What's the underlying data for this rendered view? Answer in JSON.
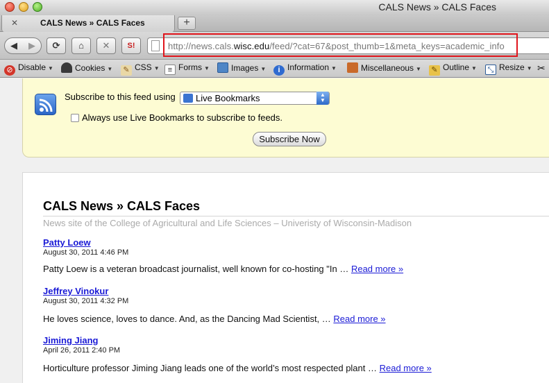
{
  "window": {
    "title": "CALS News » CALS Faces"
  },
  "tabs": [
    {
      "label": "CALS News » CALS Faces",
      "close_glyph": "✕"
    }
  ],
  "new_tab": {
    "label": "+"
  },
  "nav": {
    "back_glyph": "◀",
    "forward_glyph": "▶",
    "reload_glyph": "⟳",
    "home_glyph": "⌂",
    "stop_glyph": "✕",
    "si_label": "S!",
    "url_prefix": "http://news.cals.",
    "url_domain": "wisc.edu",
    "url_suffix": "/feed/?cat=67&post_thumb=1&meta_keys=academic_info"
  },
  "devbar": {
    "items": [
      {
        "label": "Disable",
        "icon": "disable-icon"
      },
      {
        "label": "Cookies",
        "icon": "cookies-icon"
      },
      {
        "label": "CSS",
        "icon": "css-icon"
      },
      {
        "label": "Forms",
        "icon": "forms-icon"
      },
      {
        "label": "Images",
        "icon": "images-icon"
      },
      {
        "label": "Information",
        "icon": "information-icon"
      },
      {
        "label": "Miscellaneous",
        "icon": "miscellaneous-icon"
      },
      {
        "label": "Outline",
        "icon": "outline-icon"
      },
      {
        "label": "Resize",
        "icon": "resize-icon"
      }
    ]
  },
  "subscribe": {
    "label": "Subscribe to this feed using",
    "reader_selected": "Live Bookmarks",
    "always_label": "Always use Live Bookmarks to subscribe to feeds.",
    "always_checked": false,
    "button_label": "Subscribe Now"
  },
  "feed": {
    "title": "CALS News » CALS Faces",
    "subtitle": "News site of the College of Agricultural and Life Sciences – Univeristy of Wisconsin-Madison",
    "entries": [
      {
        "title": "Patty Loew",
        "date": "August 30, 2011 4:46 PM",
        "summary": "Patty Loew is a veteran broadcast journalist, well known for co-hosting \"In … ",
        "more": "Read more »"
      },
      {
        "title": "Jeffrey Vinokur",
        "date": "August 30, 2011 4:32 PM",
        "summary": "He loves science, loves to dance. And, as the Dancing Mad Scientist, … ",
        "more": "Read more »"
      },
      {
        "title": "Jiming Jiang",
        "date": "April 26, 2011 2:40 PM",
        "summary": "Horticulture professor Jiming Jiang leads one of the world’s most respected plant … ",
        "more": "Read more »"
      }
    ]
  },
  "colors": {
    "highlight_box": "#e0141b",
    "link": "#1a1ad6",
    "feed_header_bg": "#fdfcd3"
  }
}
